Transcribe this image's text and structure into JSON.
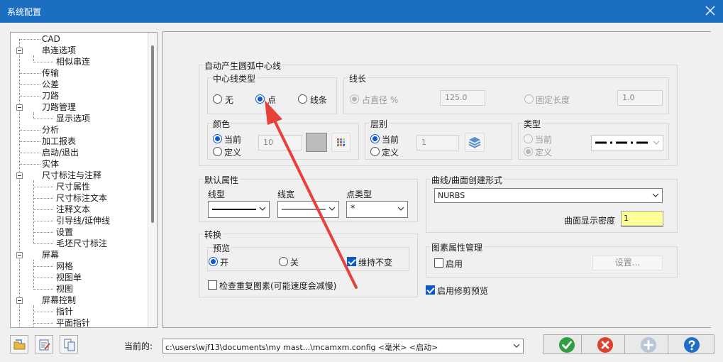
{
  "window": {
    "title": "系统配置"
  },
  "tree": {
    "items": [
      {
        "label": "CAD"
      },
      {
        "label": "串连选项"
      },
      {
        "label": "相似串连"
      },
      {
        "label": "传输"
      },
      {
        "label": "公差"
      },
      {
        "label": "刀路"
      },
      {
        "label": "刀路管理"
      },
      {
        "label": "显示选项"
      },
      {
        "label": "分析"
      },
      {
        "label": "加工报表"
      },
      {
        "label": "启动/退出"
      },
      {
        "label": "实体"
      },
      {
        "label": "尺寸标注与注释"
      },
      {
        "label": "尺寸属性"
      },
      {
        "label": "尺寸标注文本"
      },
      {
        "label": "注释文本"
      },
      {
        "label": "引导线/延伸线"
      },
      {
        "label": "设置"
      },
      {
        "label": "毛坯尺寸标注"
      },
      {
        "label": "屏幕"
      },
      {
        "label": "网格"
      },
      {
        "label": "视图单"
      },
      {
        "label": "视图"
      },
      {
        "label": "屏幕控制"
      },
      {
        "label": "指针"
      },
      {
        "label": "平面指针"
      }
    ]
  },
  "arc_center": {
    "title": "自动产生圆弧中心线",
    "line_type": {
      "title": "中心线类型",
      "options": [
        "无",
        "点",
        "线条"
      ],
      "selected": "点"
    },
    "length": {
      "title": "线长",
      "diameter_label": "占直径 %",
      "diameter_value": "125.0",
      "fixed_label": "固定长度",
      "fixed_value": "1.0"
    },
    "color": {
      "title": "颜色",
      "current_label": "当前",
      "define_label": "定义",
      "value": "10"
    },
    "level": {
      "title": "层别",
      "current_label": "当前",
      "define_label": "定义",
      "value": "1"
    },
    "type": {
      "title": "类型",
      "current_label": "当前",
      "define_label": "定义"
    }
  },
  "default_attrs": {
    "title": "默认属性",
    "line_style_label": "线型",
    "line_width_label": "线宽",
    "point_type_label": "点类型",
    "point_type_value": "*"
  },
  "convert": {
    "title": "转换",
    "preview_title": "预览",
    "on_label": "开",
    "off_label": "关",
    "keep_label": "维持不变",
    "check_duplicates_label": "检查重复图素(可能速度会减慢)"
  },
  "surface": {
    "title": "曲线/曲面创建形式",
    "form_value": "NURBS",
    "density_label": "曲面显示密度",
    "density_value": "1"
  },
  "entity_attr": {
    "title": "图素属性管理",
    "enable_label": "启用",
    "settings_label": "设置..."
  },
  "trim_preview_label": "启用修剪预览",
  "footer": {
    "current_label": "当前的:",
    "config_path": "c:\\users\\wjf13\\documents\\my mast...\\mcamxm.config <毫米> <启动>"
  },
  "colors": {
    "titlebar": "#1b6ec2",
    "accent": "#0a58ca",
    "annotation_arrow": "#e8403a",
    "density_field": "#ffff99"
  }
}
